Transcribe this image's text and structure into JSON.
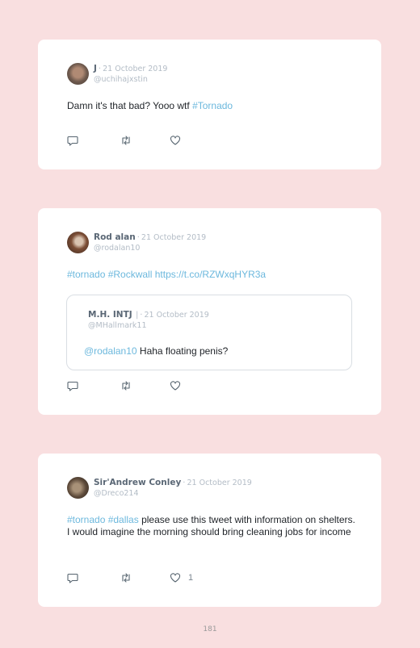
{
  "tweets": [
    {
      "name": "J",
      "date": "21 October 2019",
      "handle": "@uchihajxstin",
      "text_parts": [
        "Damn it's that bad? Yooo wtf ",
        "#Tornado"
      ],
      "like_count": ""
    },
    {
      "name": "Rod alan",
      "date": "21 October 2019",
      "handle": "@rodalan10",
      "text_parts": [
        "#tornado #Rockwall https://t.co/RZWxqHYR3a"
      ],
      "quote": {
        "name": "M.H. INTJ",
        "separator": "|",
        "date": "21 October 2019",
        "handle": "@MHallmark11",
        "mention": "@rodalan10",
        "text": " Haha floating penis?"
      },
      "like_count": ""
    },
    {
      "name": "Sir'Andrew Conley",
      "date": "21 October 2019",
      "handle": "@Dreco214",
      "text_parts": [
        "#tornado #dallas",
        " please use this tweet with information on shelters. I would imagine the morning should bring cleaning jobs for income"
      ],
      "like_count": "1"
    }
  ],
  "dot": "·",
  "icons": {
    "reply": "reply-icon",
    "retweet": "retweet-icon",
    "like": "heart-icon"
  },
  "colors": {
    "background": "#f9dfe0",
    "link": "#6cb8dd",
    "card": "#ffffff"
  },
  "page_number": "181"
}
